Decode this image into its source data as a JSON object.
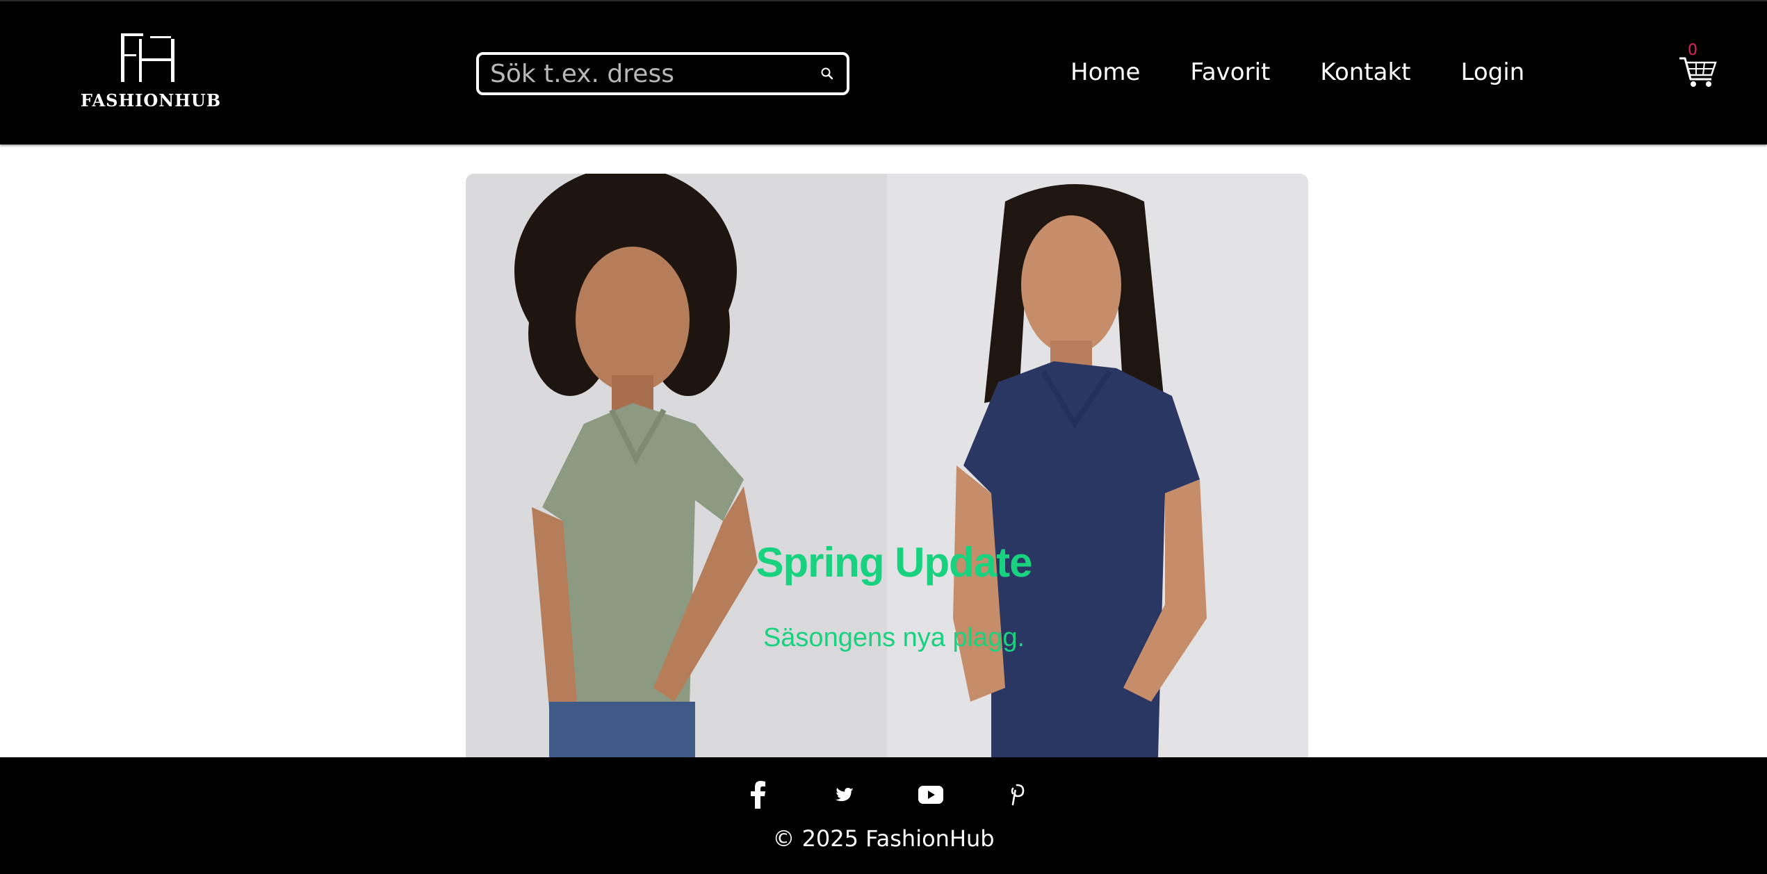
{
  "header": {
    "logo": {
      "monogram": "FH",
      "wordmark": "FASHIONHUB"
    },
    "search": {
      "placeholder": "Sök t.ex. dress",
      "value": ""
    },
    "nav": [
      {
        "label": "Home"
      },
      {
        "label": "Favorit"
      },
      {
        "label": "Kontakt"
      },
      {
        "label": "Login"
      }
    ],
    "cart": {
      "count": "0",
      "icon": "cart-icon"
    }
  },
  "hero": {
    "title": "Spring Update",
    "subtitle": "Säsongens nya plagg.",
    "images": [
      {
        "name": "model-sage-vneck-tee"
      },
      {
        "name": "model-navy-vneck-tee"
      }
    ]
  },
  "footer": {
    "socials": [
      {
        "icon": "facebook-icon"
      },
      {
        "icon": "twitter-icon"
      },
      {
        "icon": "youtube-icon"
      },
      {
        "icon": "pinterest-icon"
      }
    ],
    "copyright": "© 2025 FashionHub"
  },
  "colors": {
    "header_bg": "#000000",
    "accent_green": "#19d27f",
    "cart_badge": "#e0245e",
    "text_light": "#ffffff"
  }
}
